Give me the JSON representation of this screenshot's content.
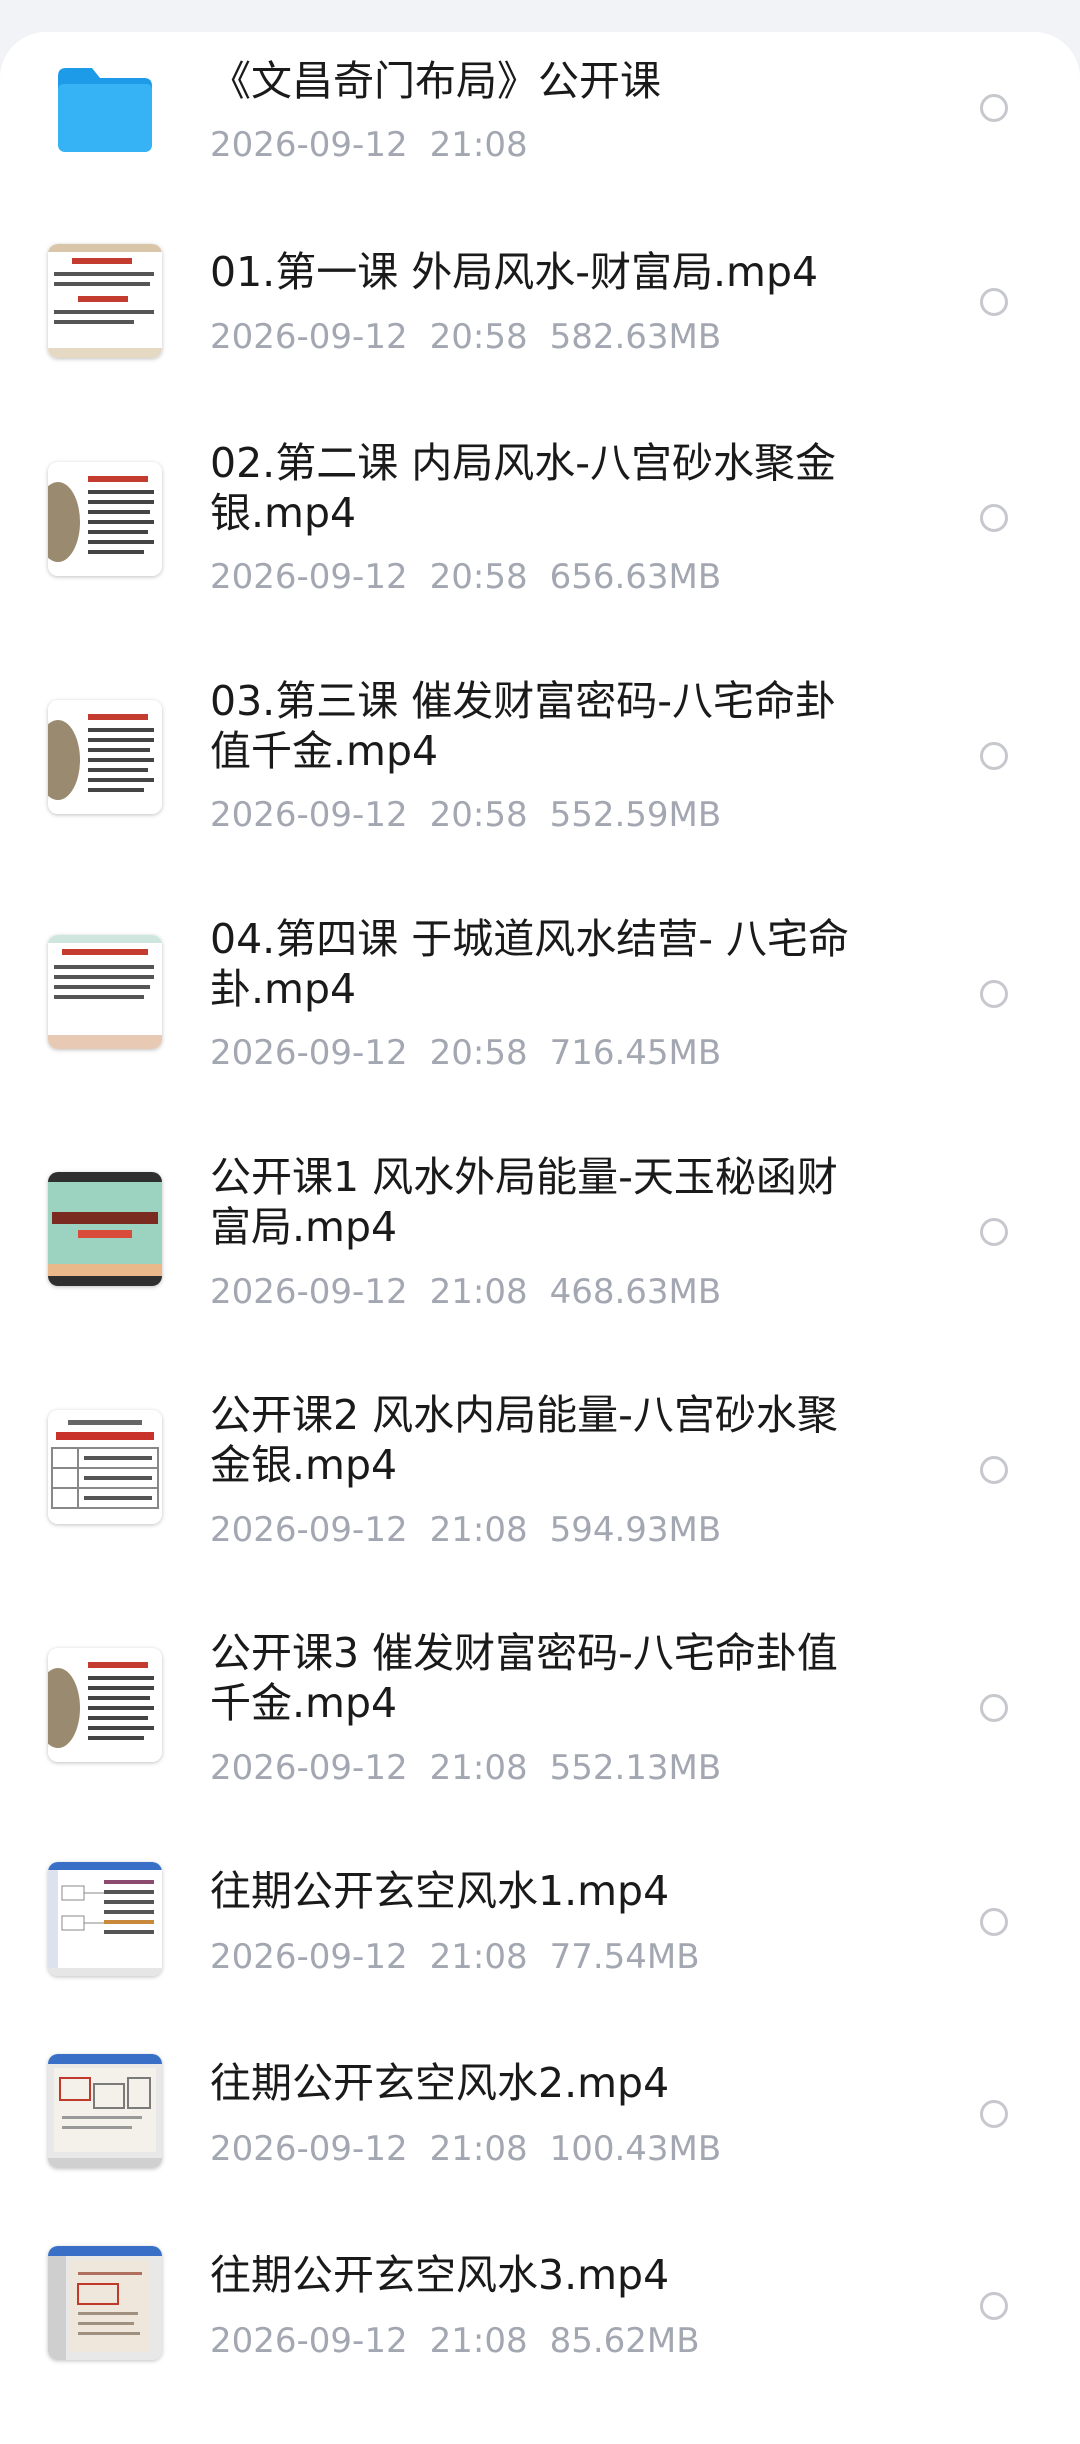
{
  "files": [
    {
      "name": "《文昌奇门布局》公开课",
      "date": "2026-09-12",
      "time": "21:08",
      "size": "",
      "icon": "folder-icon",
      "thumb": "folder"
    },
    {
      "name": "01.第一课 外局风水-财富局.mp4",
      "date": "2026-09-12",
      "time": "20:58",
      "size": "582.63MB",
      "icon": "video-thumbnail-icon",
      "thumb": "slide-red"
    },
    {
      "name": "02.第二课 内局风水-八宫砂水聚金银.mp4",
      "date": "2026-09-12",
      "time": "20:58",
      "size": "656.63MB",
      "icon": "video-thumbnail-icon",
      "thumb": "slide-person"
    },
    {
      "name": "03.第三课 催发财富密码-八宅命卦值千金.mp4",
      "date": "2026-09-12",
      "time": "20:58",
      "size": "552.59MB",
      "icon": "video-thumbnail-icon",
      "thumb": "slide-person"
    },
    {
      "name": "04.第四课 于城道风水结营- 八宅命卦.mp4",
      "date": "2026-09-12",
      "time": "20:58",
      "size": "716.45MB",
      "icon": "video-thumbnail-icon",
      "thumb": "slide-green"
    },
    {
      "name": "公开课1 风水外局能量-天玉秘函财富局.mp4",
      "date": "2026-09-12",
      "time": "21:08",
      "size": "468.63MB",
      "icon": "video-thumbnail-icon",
      "thumb": "banner-green"
    },
    {
      "name": "公开课2 风水内局能量-八宫砂水聚金银.mp4",
      "date": "2026-09-12",
      "time": "21:08",
      "size": "594.93MB",
      "icon": "video-thumbnail-icon",
      "thumb": "table-red"
    },
    {
      "name": "公开课3 催发财富密码-八宅命卦值千金.mp4",
      "date": "2026-09-12",
      "time": "21:08",
      "size": "552.13MB",
      "icon": "video-thumbnail-icon",
      "thumb": "slide-person"
    },
    {
      "name": "往期公开玄空风水1.mp4",
      "date": "2026-09-12",
      "time": "21:08",
      "size": "77.54MB",
      "icon": "video-thumbnail-icon",
      "thumb": "screen-diagram"
    },
    {
      "name": "往期公开玄空风水2.mp4",
      "date": "2026-09-12",
      "time": "21:08",
      "size": "100.43MB",
      "icon": "video-thumbnail-icon",
      "thumb": "screen-paper"
    },
    {
      "name": "往期公开玄空风水3.mp4",
      "date": "2026-09-12",
      "time": "21:08",
      "size": "85.62MB",
      "icon": "video-thumbnail-icon",
      "thumb": "screen-paper2"
    }
  ],
  "colors": {
    "folder": "#2aa7f0",
    "text": "#1a1a1a",
    "meta": "#a3a7b1",
    "radio": "#c6c8ce"
  }
}
